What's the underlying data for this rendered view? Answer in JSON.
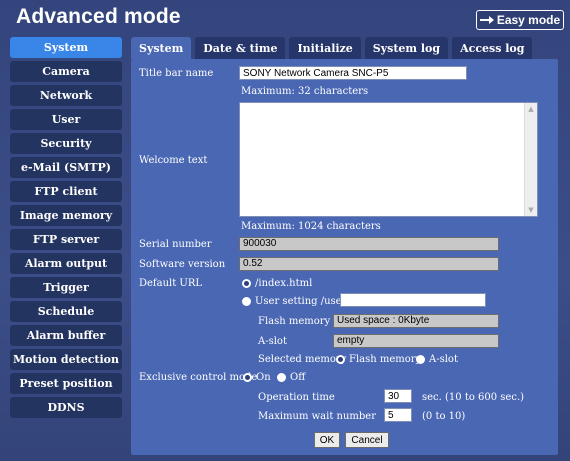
{
  "header": {
    "title": "Advanced mode",
    "easy_mode_label": "Easy mode"
  },
  "sidebar": {
    "items": [
      {
        "label": "System",
        "active": true
      },
      {
        "label": "Camera"
      },
      {
        "label": "Network"
      },
      {
        "label": "User"
      },
      {
        "label": "Security"
      },
      {
        "label": "e-Mail (SMTP)"
      },
      {
        "label": "FTP client"
      },
      {
        "label": "Image memory"
      },
      {
        "label": "FTP server"
      },
      {
        "label": "Alarm output"
      },
      {
        "label": "Trigger"
      },
      {
        "label": "Schedule"
      },
      {
        "label": "Alarm buffer"
      },
      {
        "label": "Motion detection"
      },
      {
        "label": "Preset position"
      },
      {
        "label": "DDNS"
      }
    ]
  },
  "tabs": [
    {
      "label": "System",
      "active": true
    },
    {
      "label": "Date & time"
    },
    {
      "label": "Initialize"
    },
    {
      "label": "System log"
    },
    {
      "label": "Access log"
    }
  ],
  "form": {
    "title_bar_name": {
      "label": "Title bar name",
      "value": "SONY Network Camera SNC-P5",
      "hint": "Maximum: 32 characters"
    },
    "welcome_text": {
      "label": "Welcome text",
      "value": "",
      "hint": "Maximum: 1024 characters"
    },
    "serial_number": {
      "label": "Serial number",
      "value": "900030"
    },
    "software_version": {
      "label": "Software version",
      "value": "0.52"
    },
    "default_url": {
      "label": "Default URL",
      "option_index": "/index.html",
      "option_user": "User setting  /user/",
      "user_value": "",
      "selected": "index"
    },
    "flash_memory": {
      "label": "Flash memory",
      "value": "Used space : 0Kbyte"
    },
    "a_slot": {
      "label": "A-slot",
      "value": "empty"
    },
    "selected_memory": {
      "label": "Selected memory",
      "options": [
        "Flash memory",
        "A-slot"
      ],
      "selected": "Flash memory"
    },
    "exclusive_control": {
      "label": "Exclusive control mode",
      "options": [
        "On",
        "Off"
      ],
      "selected": "On"
    },
    "operation_time": {
      "label": "Operation time",
      "value": "30",
      "hint": "sec. (10 to 600 sec.)"
    },
    "max_wait": {
      "label": "Maximum wait number",
      "value": "5",
      "hint": "(0 to 10)"
    }
  },
  "buttons": {
    "ok": "OK",
    "cancel": "Cancel"
  },
  "colors": {
    "background": "#3d4f8a",
    "panel": "#4a67b3",
    "active": "#3a86e8",
    "sidebar_item": "#243460"
  }
}
